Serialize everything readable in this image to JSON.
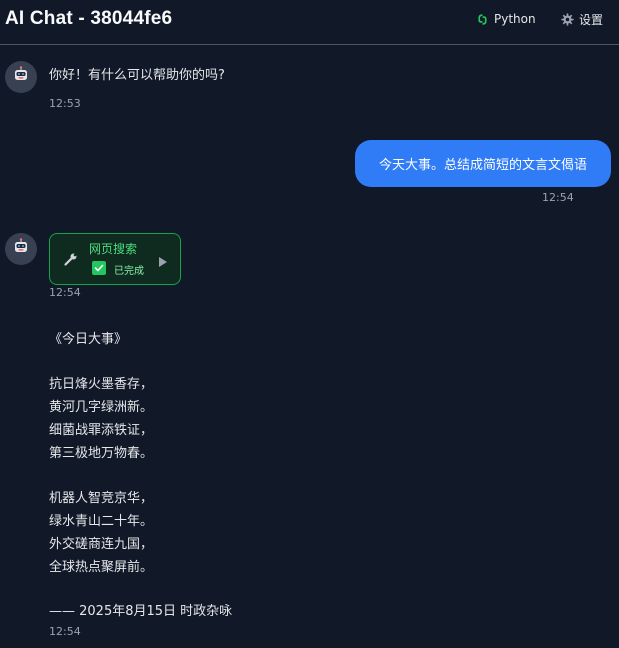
{
  "header": {
    "title": "AI Chat - 38044fe6",
    "python_label": "Python",
    "settings_label": "设置"
  },
  "messages": {
    "greeting": {
      "text": "你好！有什么可以帮助你的吗?",
      "time": "12:53"
    },
    "user": {
      "text": "今天大事。总结成简短的文言文偈语",
      "time": "12:54"
    },
    "tool": {
      "name": "网页搜索",
      "status": "已完成",
      "time": "12:54"
    },
    "poem": {
      "lines": [
        "《今日大事》",
        "抗日烽火墨香存，",
        "黄河几字绿洲新。",
        "细菌战罪添铁证，",
        "第三极地万物春。",
        "机器人智竞京华，",
        "绿水青山二十年。",
        "外交磋商连九国，",
        "全球热点聚屏前。",
        "—— 2025年8月15日 时政杂咏"
      ],
      "time": "12:54"
    }
  },
  "icons": {
    "python": "python-icon",
    "settings": "gear-icon",
    "avatar": "robot-icon",
    "tool": "wrench-icon",
    "check": "checkbox-checked-icon",
    "expand": "play-icon"
  },
  "colors": {
    "background": "#111827",
    "user_bubble": "#2f7cf6",
    "tool_border": "#16a34a",
    "tool_text": "#4ade80",
    "python_icon": "#22c55e"
  }
}
